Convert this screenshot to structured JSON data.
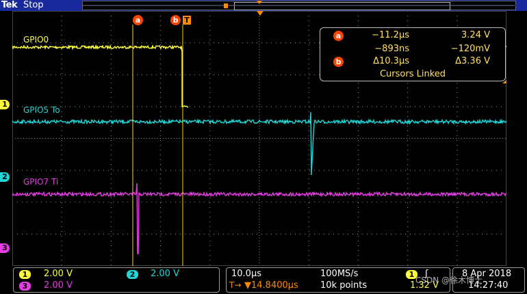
{
  "header": {
    "brand": "Tek",
    "state": "Stop",
    "trigger_marker": "T"
  },
  "colors": {
    "ch1": "#ffff3c",
    "ch2": "#1fd6d6",
    "ch3": "#e63ce6",
    "cursor": "#ffd21e",
    "accent": "#ff8c00",
    "cursor_badge": "#ff4400",
    "grid": "#9a9a9a"
  },
  "traces": [
    {
      "id": "ch1",
      "label": "GPIO0",
      "marker": "1"
    },
    {
      "id": "ch2",
      "label": "GPIO5 To",
      "marker": "2"
    },
    {
      "id": "ch3",
      "label": "GPIO7 Ti",
      "marker": "3"
    }
  ],
  "cursors": {
    "a": {
      "label": "a",
      "time": "−11.2µs",
      "volt": "3.24 V"
    },
    "a2": {
      "time": "−893ns",
      "volt": "−120mV"
    },
    "b": {
      "label": "b",
      "delta_time": "Δ10.3µs",
      "delta_volt": "Δ3.36 V"
    },
    "status": "Cursors Linked"
  },
  "channel_settings": [
    {
      "marker": "1",
      "scale": "2.00 V"
    },
    {
      "marker": "2",
      "scale": "2.00 V"
    },
    {
      "marker": "3",
      "scale": "2.00 V"
    }
  ],
  "timebase": {
    "scale": "10.0µs",
    "rate": "100MS/s",
    "position": "▼14.8400µs",
    "record": "10k points",
    "position_marker": "T→"
  },
  "trigger": {
    "source": "1",
    "edge": "ʃ",
    "level": "1.32 V"
  },
  "datetime": {
    "date": "8 Apr 2018",
    "time": "14:27:40"
  },
  "watermark": "CSDN @徐木博士"
}
